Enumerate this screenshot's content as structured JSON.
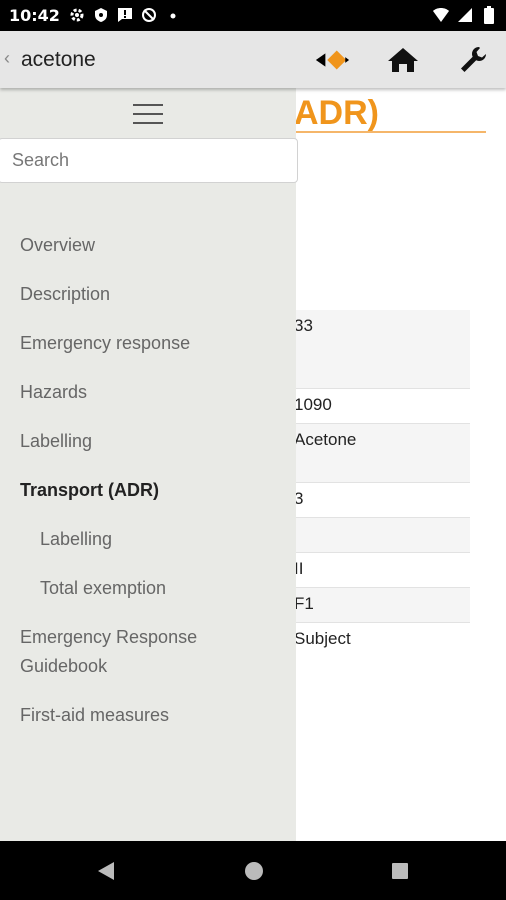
{
  "status_bar": {
    "time": "10:42",
    "left_icons": [
      "gear-icon",
      "shield-icon",
      "message-icon",
      "no-data-icon",
      "dot-icon"
    ],
    "right_icons": [
      "wifi-icon",
      "signal-icon",
      "battery-icon"
    ]
  },
  "toolbar": {
    "title": "acetone",
    "buttons": [
      "logo-icon",
      "home-icon",
      "wrench-icon"
    ],
    "accent_color": "#f0951c"
  },
  "content": {
    "heading": "ADR)",
    "rows": [
      "33",
      "1090",
      "Acetone",
      "3",
      "",
      "II",
      "F1",
      "Subject"
    ]
  },
  "drawer": {
    "search_placeholder": "Search",
    "items": [
      {
        "label": "Overview"
      },
      {
        "label": "Description"
      },
      {
        "label": "Emergency response"
      },
      {
        "label": "Hazards"
      },
      {
        "label": "Labelling"
      },
      {
        "label": "Transport (ADR)"
      },
      {
        "label": "Labelling"
      },
      {
        "label": "Total exemption"
      },
      {
        "label": "Emergency Response\nGuidebook"
      },
      {
        "label": "First-aid measures"
      }
    ]
  },
  "nav_bar": {
    "buttons": [
      "back-icon",
      "home-circle-icon",
      "recents-icon"
    ]
  }
}
